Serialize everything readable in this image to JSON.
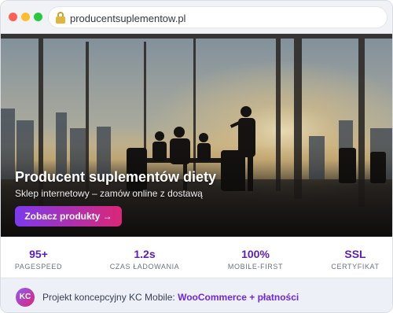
{
  "browser": {
    "url": "producentsuplementow.pl"
  },
  "hero": {
    "title": "Producent suplementów diety",
    "subtitle": "Sklep internetowy – zamów online z dostawą",
    "cta_label": "Zobacz produkty →"
  },
  "stats": [
    {
      "value": "95+",
      "label": "PAGESPEED"
    },
    {
      "value": "1.2s",
      "label": "CZAS ŁADOWANIA"
    },
    {
      "value": "100%",
      "label": "MOBILE-FIRST"
    },
    {
      "value": "SSL",
      "label": "CERTYFIKAT"
    }
  ],
  "footer": {
    "avatar_initials": "KC",
    "text": "Projekt koncepcyjny KC Mobile:",
    "link_text": "WooCommerce + płatności"
  },
  "colors": {
    "accent": "#5b21b6",
    "cta_gradient_start": "#7c3aed",
    "cta_gradient_end": "#db2777",
    "traffic_red": "#ff5f57",
    "traffic_yellow": "#febc2e",
    "traffic_green": "#28c840"
  }
}
